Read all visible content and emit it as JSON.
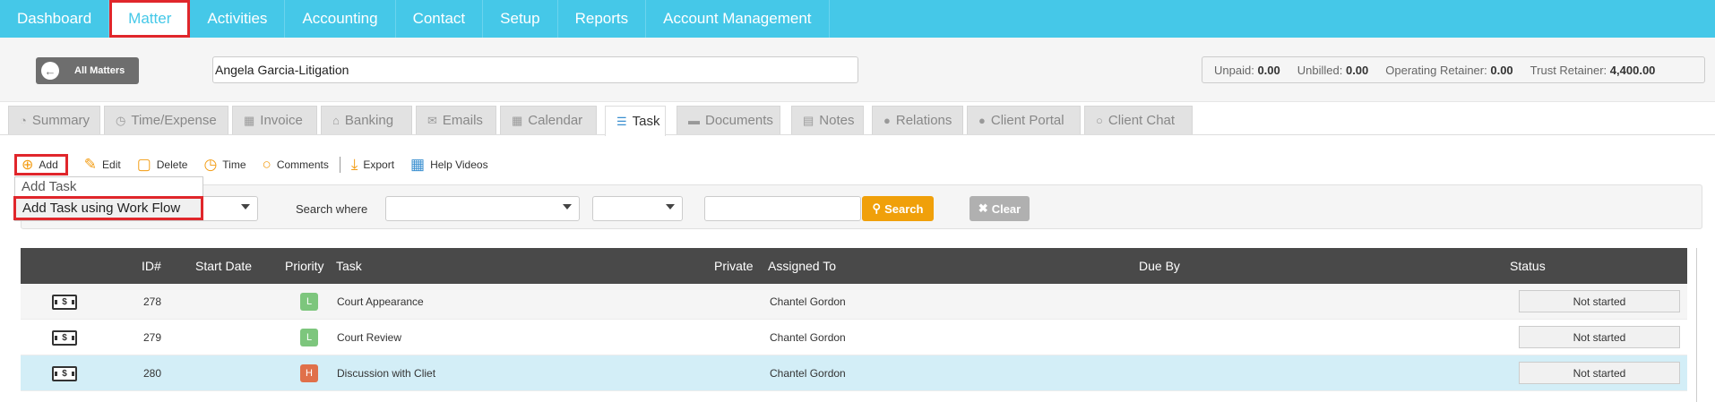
{
  "nav": {
    "items": [
      {
        "label": "Dashboard",
        "active": false
      },
      {
        "label": "Matter",
        "active": true
      },
      {
        "label": "Activities",
        "active": false
      },
      {
        "label": "Accounting",
        "active": false
      },
      {
        "label": "Contact",
        "active": false
      },
      {
        "label": "Setup",
        "active": false
      },
      {
        "label": "Reports",
        "active": false
      },
      {
        "label": "Account Management",
        "active": false
      }
    ]
  },
  "matter": {
    "all_matters_label": "All Matters",
    "name_value": "Angela Garcia-Litigation",
    "balances": [
      {
        "label": "Unpaid:",
        "value": "0.00"
      },
      {
        "label": "Unbilled:",
        "value": "0.00"
      },
      {
        "label": "Operating Retainer:",
        "value": "0.00"
      },
      {
        "label": "Trust Retainer:",
        "value": "4,400.00"
      }
    ]
  },
  "tabs": [
    {
      "label": "Summary",
      "icon": "dashboard-icon",
      "glyph": "◔",
      "active": false
    },
    {
      "label": "Time/Expense",
      "icon": "clock-icon",
      "glyph": "◷",
      "active": false
    },
    {
      "label": "Invoice",
      "icon": "calculator-icon",
      "glyph": "▦",
      "active": false
    },
    {
      "label": "Banking",
      "icon": "bank-icon",
      "glyph": "⌂",
      "active": false
    },
    {
      "label": "Emails",
      "icon": "envelope-icon",
      "glyph": "✉",
      "active": false
    },
    {
      "label": "Calendar",
      "icon": "calendar-icon",
      "glyph": "▦",
      "active": false
    },
    {
      "label": "Task",
      "icon": "tasks-icon",
      "glyph": "☰",
      "active": true
    },
    {
      "label": "Documents",
      "icon": "folder-icon",
      "glyph": "▬",
      "active": false
    },
    {
      "label": "Notes",
      "icon": "file-icon",
      "glyph": "▤",
      "active": false
    },
    {
      "label": "Relations",
      "icon": "users-icon",
      "glyph": "●",
      "active": false
    },
    {
      "label": "Client Portal",
      "icon": "user-key-icon",
      "glyph": "●",
      "active": false
    },
    {
      "label": "Client Chat",
      "icon": "chat-icon",
      "glyph": "○",
      "active": false
    }
  ],
  "toolbar": {
    "add": "Add",
    "edit": "Edit",
    "delete": "Delete",
    "time": "Time",
    "comments": "Comments",
    "export": "Export",
    "help_videos": "Help Videos"
  },
  "add_menu": {
    "option1": "Add Task",
    "option2": "Add Task using Work Flow"
  },
  "search": {
    "where_label": "Search where",
    "search_button": "Search",
    "clear_button": "Clear",
    "text_value": ""
  },
  "table": {
    "headers": {
      "id": "ID#",
      "start_date": "Start Date",
      "priority": "Priority",
      "task": "Task",
      "private": "Private",
      "assigned_to": "Assigned To",
      "due_by": "Due By",
      "status": "Status"
    },
    "rows": [
      {
        "id": "278",
        "start_date": "",
        "priority": "L",
        "priority_color": "#7dc67d",
        "task": "Court Appearance",
        "assigned_to": "Chantel Gordon",
        "due_by": "",
        "status": "Not started"
      },
      {
        "id": "279",
        "start_date": "",
        "priority": "L",
        "priority_color": "#7dc67d",
        "task": "Court Review",
        "assigned_to": "Chantel Gordon",
        "due_by": "",
        "status": "Not started"
      },
      {
        "id": "280",
        "start_date": "",
        "priority": "H",
        "priority_color": "#e0704a",
        "task": "Discussion with Cliet",
        "assigned_to": "Chantel Gordon",
        "due_by": "",
        "status": "Not started"
      }
    ]
  },
  "colors": {
    "nav_bg": "#45c8e8",
    "highlight_red": "#e0262b",
    "search_orange": "#f0a00a",
    "header_dark": "#494949",
    "selected_row": "#d3eef7"
  }
}
